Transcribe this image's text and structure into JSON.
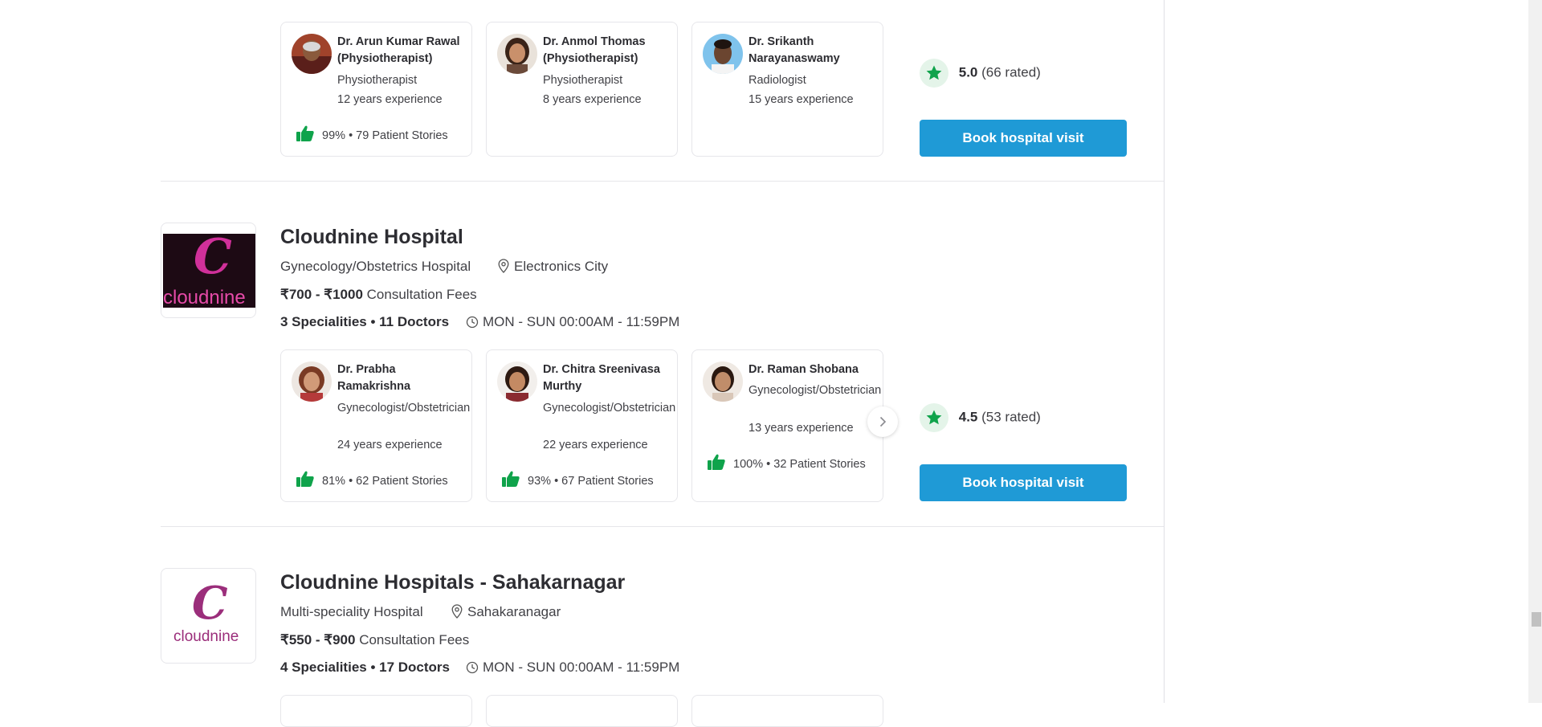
{
  "colors": {
    "accent": "#1f9ad6",
    "success_green": "#0fa34b",
    "rating_bg": "#e4f4e9",
    "brand_magenta": "#9b2e7b"
  },
  "listings": [
    {
      "doctors": [
        {
          "name": "Dr. Arun Kumar Rawal (Physiotherapist)",
          "specialty": "Physiotherapist",
          "experience": "12 years experience",
          "stories": "99% • 79 Patient Stories"
        },
        {
          "name": "Dr. Anmol Thomas (Physiotherapist)",
          "specialty": "Physiotherapist",
          "experience": "8 years experience",
          "stories": ""
        },
        {
          "name": "Dr. Srikanth Narayanaswamy",
          "specialty": "Radiologist",
          "experience": "15 years experience",
          "stories": ""
        }
      ],
      "rating": {
        "score": "5.0",
        "count": "(66 rated)"
      },
      "book_label": "Book hospital visit"
    },
    {
      "name": "Cloudnine Hospital",
      "type": "Gynecology/Obstetrics Hospital",
      "location": "Electronics City",
      "fees_range": "₹700 - ₹1000",
      "fees_label": "Consultation Fees",
      "specialities": "3 Specialities • 11 Doctors",
      "hours": "MON - SUN 00:00AM - 11:59PM",
      "logo_text": "cloudnine",
      "doctors": [
        {
          "name": "Dr. Prabha Ramakrishna",
          "specialty": "Gynecologist/Obstetrician",
          "experience": "24 years experience",
          "stories": "81% • 62 Patient Stories"
        },
        {
          "name": "Dr. Chitra Sreenivasa Murthy",
          "specialty": "Gynecologist/Obstetrician",
          "experience": "22 years experience",
          "stories": "93% • 67 Patient Stories"
        },
        {
          "name": "Dr. Raman Shobana",
          "specialty": "Gynecologist/Obstetrician",
          "experience": "13 years experience",
          "stories": "100% • 32 Patient Stories"
        }
      ],
      "rating": {
        "score": "4.5",
        "count": "(53 rated)"
      },
      "book_label": "Book hospital visit"
    },
    {
      "name": "Cloudnine Hospitals - Sahakarnagar",
      "type": "Multi-speciality Hospital",
      "location": "Sahakaranagar",
      "fees_range": "₹550 - ₹900",
      "fees_label": "Consultation Fees",
      "specialities": "4 Specialities • 17 Doctors",
      "hours": "MON - SUN 00:00AM - 11:59PM",
      "logo_text": "cloudnine"
    }
  ]
}
